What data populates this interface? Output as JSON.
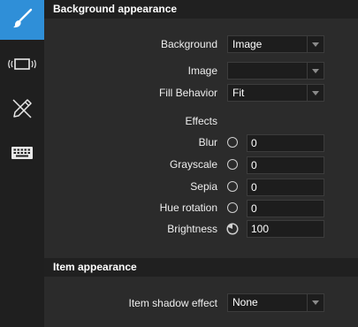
{
  "sidebar": {
    "items": [
      {
        "icon": "paintbrush-icon",
        "active": true
      },
      {
        "icon": "device-vibrate-icon",
        "active": false
      },
      {
        "icon": "pen-crossed-icon",
        "active": false
      },
      {
        "icon": "keyboard-icon",
        "active": false
      }
    ],
    "accent_color": "#2f8fd8"
  },
  "background_section": {
    "title": "Background appearance",
    "background_label": "Background",
    "background_value": "Image",
    "image_label": "Image",
    "image_value": "",
    "fill_label": "Fill Behavior",
    "fill_value": "Fit",
    "effects_label": "Effects",
    "effects": [
      {
        "label": "Blur",
        "value": "0"
      },
      {
        "label": "Grayscale",
        "value": "0"
      },
      {
        "label": "Sepia",
        "value": "0"
      },
      {
        "label": "Hue rotation",
        "value": "0"
      },
      {
        "label": "Brightness",
        "value": "100"
      }
    ]
  },
  "item_section": {
    "title": "Item appearance",
    "shadow_label": "Item shadow effect",
    "shadow_value": "None"
  }
}
